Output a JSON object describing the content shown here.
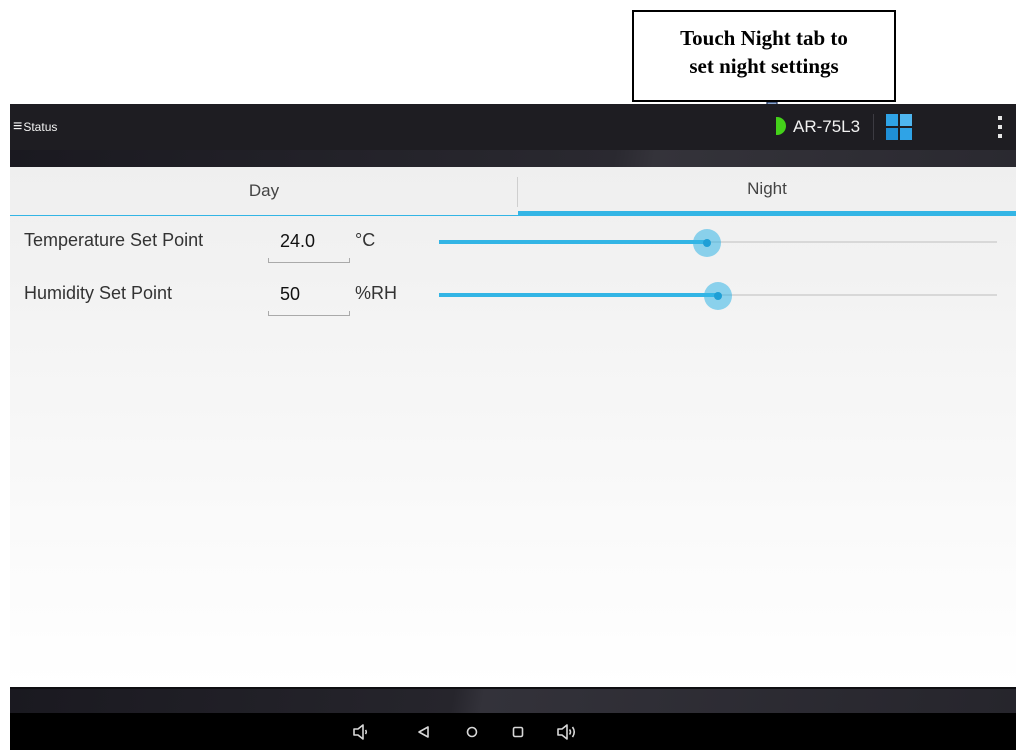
{
  "callout": {
    "line1": "Touch Night tab to",
    "line2": "set night settings"
  },
  "action_bar": {
    "menu_icon": "≡",
    "title": "Status",
    "device_name": "AR-75L3",
    "device_indicator_color": "#44d11a",
    "grid_icon": "tiles-icon",
    "overflow_icon": "overflow-menu-icon"
  },
  "tabs": [
    {
      "label": "Day",
      "selected": false
    },
    {
      "label": "Night",
      "selected": true
    }
  ],
  "settings": {
    "temperature": {
      "label": "Temperature Set Point",
      "value": "24.0",
      "unit": "°C",
      "slider_fraction": 0.48
    },
    "humidity": {
      "label": "Humidity Set Point",
      "value": "50",
      "unit": "%RH",
      "slider_fraction": 0.5
    }
  },
  "nav_bar": {
    "icons": [
      "volume-down-icon",
      "back-icon",
      "home-icon",
      "recents-icon",
      "volume-up-icon"
    ]
  },
  "colors": {
    "accent": "#33b5e5",
    "action_bar": "#1e1d22",
    "nav_bar": "#000000"
  }
}
